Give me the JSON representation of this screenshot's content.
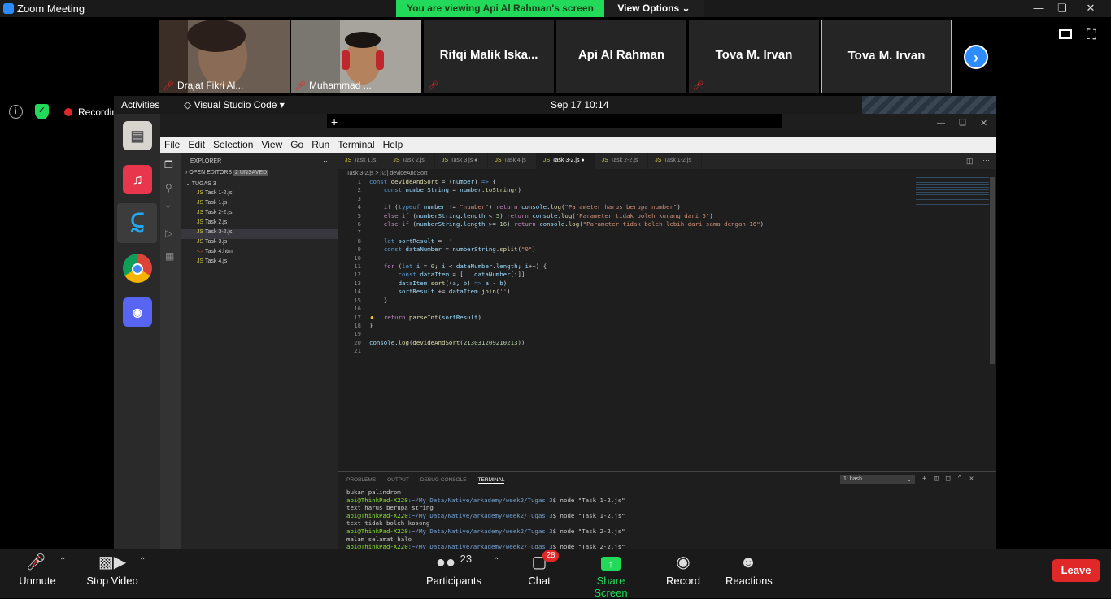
{
  "zoom": {
    "window_title": "Zoom Meeting",
    "viewing_banner": "You are viewing Api Al Rahman's screen",
    "view_options": "View Options"
  },
  "participants": [
    {
      "label": "Drajat Fikri Al...",
      "muted": true,
      "video": true
    },
    {
      "label": "Muhammad ...",
      "muted": true,
      "video": true
    },
    {
      "name": "Rifqi  Malik Iska...",
      "muted": true
    },
    {
      "name": "Api Al Rahman",
      "muted": false
    },
    {
      "name": "Tova M. Irvan",
      "muted": true
    },
    {
      "name": "Tova M. Irvan",
      "muted": false,
      "active_speaker": true
    }
  ],
  "status": {
    "recording": "Recording"
  },
  "ubuntu": {
    "activities": "Activities",
    "app_name": "Visual Studio Code",
    "clock": "Sep 17  10:14"
  },
  "vscode": {
    "menu": [
      "File",
      "Edit",
      "Selection",
      "View",
      "Go",
      "Run",
      "Terminal",
      "Help"
    ],
    "explorer": {
      "header": "EXPLORER",
      "open_editors": "OPEN EDITORS",
      "unsaved": "2 UNSAVED",
      "folder": "TUGAS 3",
      "files": [
        "Task 1-2.js",
        "Task 1.js",
        "Task 2-2.js",
        "Task 2.js",
        "Task 3-2.js",
        "Task 3.js",
        "Task 4.html",
        "Task 4.js"
      ]
    },
    "tabs": [
      "Task 1.js",
      "Task 2.js",
      "Task 3.js",
      "Task 4.js",
      "Task 3-2.js",
      "Task 2-2.js",
      "Task 1-2.js"
    ],
    "breadcrumb": "Task 3-2.js  >  [∅] devideAndSort",
    "terminal_tabs": [
      "PROBLEMS",
      "OUTPUT",
      "DEBUG CONSOLE",
      "TERMINAL"
    ],
    "terminal_select": "1: bash",
    "terminal_lines": [
      {
        "text": "bukan palindrom"
      },
      {
        "prompt": "api@ThinkPad-X220",
        "path": ":~/My Data/Native/arkademy/week2/Tugas 3",
        "cmd": "$ node \"Task 1-2.js\""
      },
      {
        "text": "text harus berupa string"
      },
      {
        "prompt": "api@ThinkPad-X220",
        "path": ":~/My Data/Native/arkademy/week2/Tugas 3",
        "cmd": "$ node \"Task 1-2.js\""
      },
      {
        "text": "text tidak boleh kosong"
      },
      {
        "prompt": "api@ThinkPad-X220",
        "path": ":~/My Data/Native/arkademy/week2/Tugas 3",
        "cmd": "$ node \"Task 2-2.js\""
      },
      {
        "text": "malam selamat halo"
      },
      {
        "prompt": "api@ThinkPad-X220",
        "path": ":~/My Data/Native/arkademy/week2/Tugas 3",
        "cmd": "$ node \"Task 2-2.js\""
      }
    ]
  },
  "toolbar": {
    "unmute": "Unmute",
    "stop_video": "Stop Video",
    "participants": "Participants",
    "participant_count": "23",
    "chat": "Chat",
    "chat_badge": "28",
    "share_screen": "Share Screen",
    "record": "Record",
    "reactions": "Reactions",
    "leave": "Leave"
  }
}
